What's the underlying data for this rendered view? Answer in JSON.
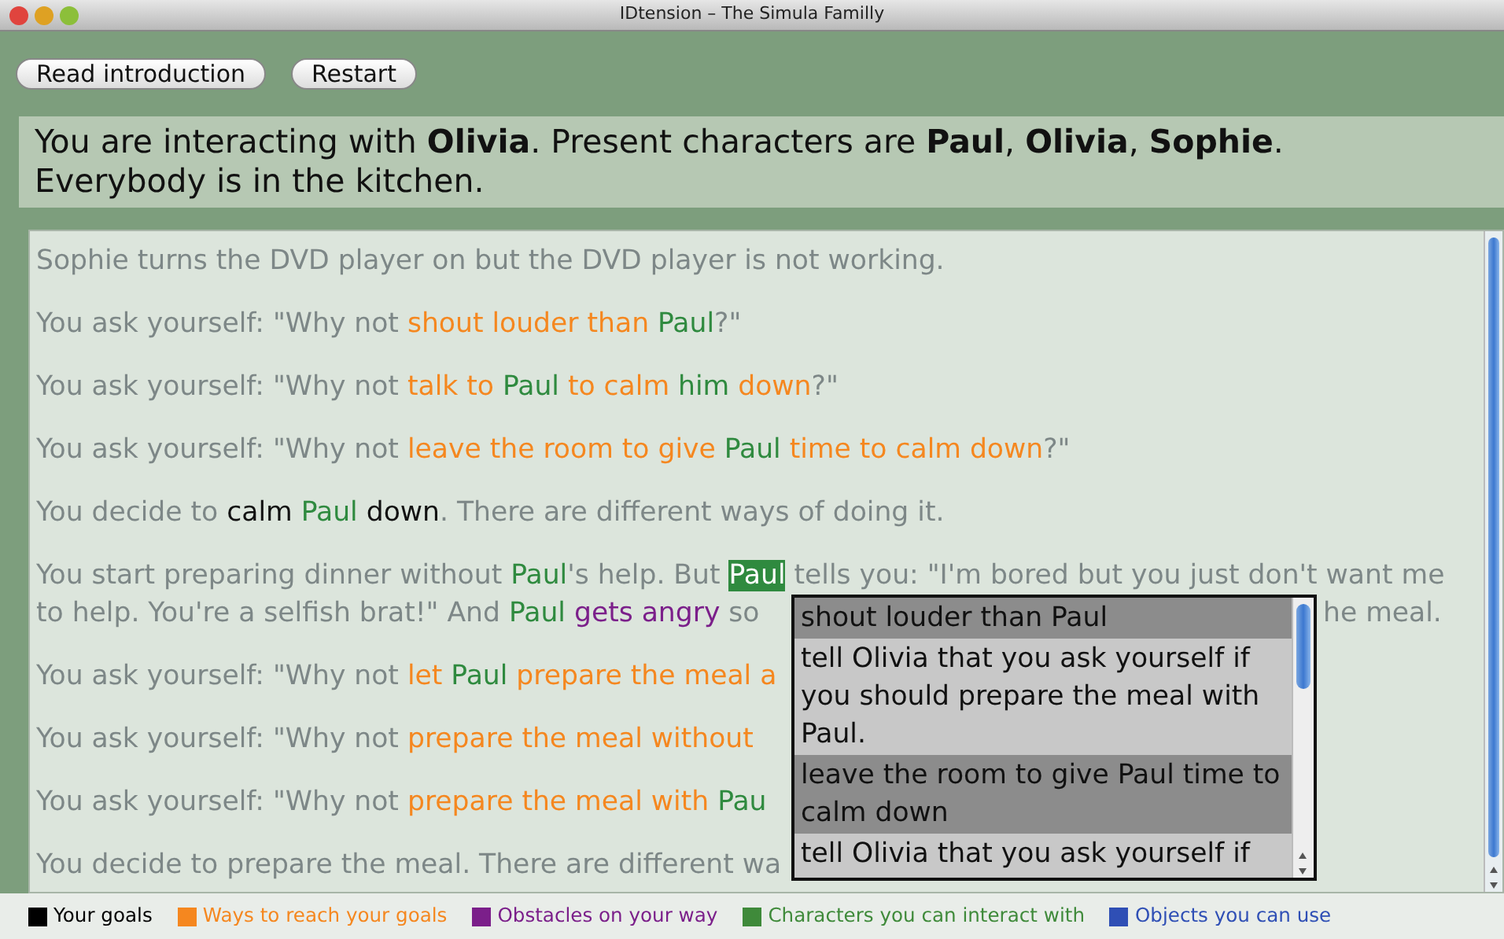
{
  "window": {
    "title": "IDtension – The Simula Familly"
  },
  "toolbar": {
    "buttons": [
      "Read introduction",
      "Restart"
    ]
  },
  "info": {
    "lines": [
      "You are interacting with **Olivia**. Present characters are **Paul**, **Olivia**, **Sophie**.",
      "Everybody is in the kitchen."
    ]
  },
  "story": [
    {
      "lines": [
        {
          "segments": [
            {
              "kind": "plain",
              "text": "Sophie turns the DVD player on but the DVD player is not working."
            }
          ]
        }
      ]
    },
    {
      "lines": [
        {
          "segments": [
            {
              "kind": "plain",
              "text": "You ask yourself: \"Why not "
            },
            {
              "kind": "way",
              "text": "shout louder than "
            },
            {
              "kind": "character",
              "text": "Paul"
            },
            {
              "kind": "plain",
              "text": "?\""
            }
          ]
        }
      ]
    },
    {
      "lines": [
        {
          "segments": [
            {
              "kind": "plain",
              "text": "You ask yourself: \"Why not "
            },
            {
              "kind": "way",
              "text": "talk to "
            },
            {
              "kind": "character",
              "text": "Paul "
            },
            {
              "kind": "way",
              "text": "to calm "
            },
            {
              "kind": "character",
              "text": "him "
            },
            {
              "kind": "way",
              "text": "down"
            },
            {
              "kind": "plain",
              "text": "?\""
            }
          ]
        }
      ]
    },
    {
      "lines": [
        {
          "segments": [
            {
              "kind": "plain",
              "text": "You ask yourself: \"Why not "
            },
            {
              "kind": "way",
              "text": "leave the room to give "
            },
            {
              "kind": "character",
              "text": "Paul "
            },
            {
              "kind": "way",
              "text": "time to calm down"
            },
            {
              "kind": "plain",
              "text": "?\""
            }
          ]
        }
      ]
    },
    {
      "lines": [
        {
          "segments": [
            {
              "kind": "plain",
              "text": "You decide to "
            },
            {
              "kind": "goal",
              "text": "calm "
            },
            {
              "kind": "character",
              "text": "Paul "
            },
            {
              "kind": "goal",
              "text": "down"
            },
            {
              "kind": "plain",
              "text": ". There are different ways of doing it."
            }
          ]
        }
      ]
    },
    {
      "lines": [
        {
          "segments": [
            {
              "kind": "plain",
              "text": "You start preparing dinner without "
            },
            {
              "kind": "character",
              "text": "Paul"
            },
            {
              "kind": "plain",
              "text": "'s help. But "
            },
            {
              "kind": "character",
              "text": "Paul",
              "highlighted": true
            },
            {
              "kind": "plain",
              "text": " tells you: \"I'm bored but you just don't want me"
            }
          ]
        },
        {
          "segments": [
            {
              "kind": "plain",
              "text": "to help. You're a selfish brat!\" And "
            },
            {
              "kind": "character",
              "text": "Paul "
            },
            {
              "kind": "obstacle",
              "text": "gets angry"
            },
            {
              "kind": "plain",
              "text": " so"
            }
          ],
          "tail": [
            {
              "kind": "plain",
              "text": "he meal."
            }
          ]
        }
      ]
    },
    {
      "lines": [
        {
          "segments": [
            {
              "kind": "plain",
              "text": "You ask yourself: \"Why not "
            },
            {
              "kind": "way",
              "text": "let "
            },
            {
              "kind": "character",
              "text": "Paul "
            },
            {
              "kind": "way",
              "text": "prepare the meal a"
            }
          ]
        }
      ]
    },
    {
      "lines": [
        {
          "segments": [
            {
              "kind": "plain",
              "text": "You ask yourself: \"Why not "
            },
            {
              "kind": "way",
              "text": "prepare the meal without"
            }
          ]
        }
      ]
    },
    {
      "lines": [
        {
          "segments": [
            {
              "kind": "plain",
              "text": "You ask yourself: \"Why not "
            },
            {
              "kind": "way",
              "text": "prepare the meal with "
            },
            {
              "kind": "character",
              "text": "Pau"
            }
          ]
        }
      ]
    },
    {
      "lines": [
        {
          "segments": [
            {
              "kind": "plain",
              "text": "You decide to prepare the meal. There are different wa"
            }
          ]
        }
      ]
    }
  ],
  "choices": [
    "shout louder than Paul",
    "tell Olivia that you ask yourself if you should prepare the meal with Paul.",
    "leave the room to give Paul time to calm down",
    "tell Olivia that you ask yourself if"
  ],
  "legend": [
    {
      "label": "Your goals",
      "color": "#000000"
    },
    {
      "label": "Ways to reach your goals",
      "color": "#f5871f"
    },
    {
      "label": "Obstacles on your way",
      "color": "#7b1f8a"
    },
    {
      "label": "Characters you can interact with",
      "color": "#3f8a3a"
    },
    {
      "label": "Objects you can use",
      "color": "#2f4fb5"
    }
  ]
}
